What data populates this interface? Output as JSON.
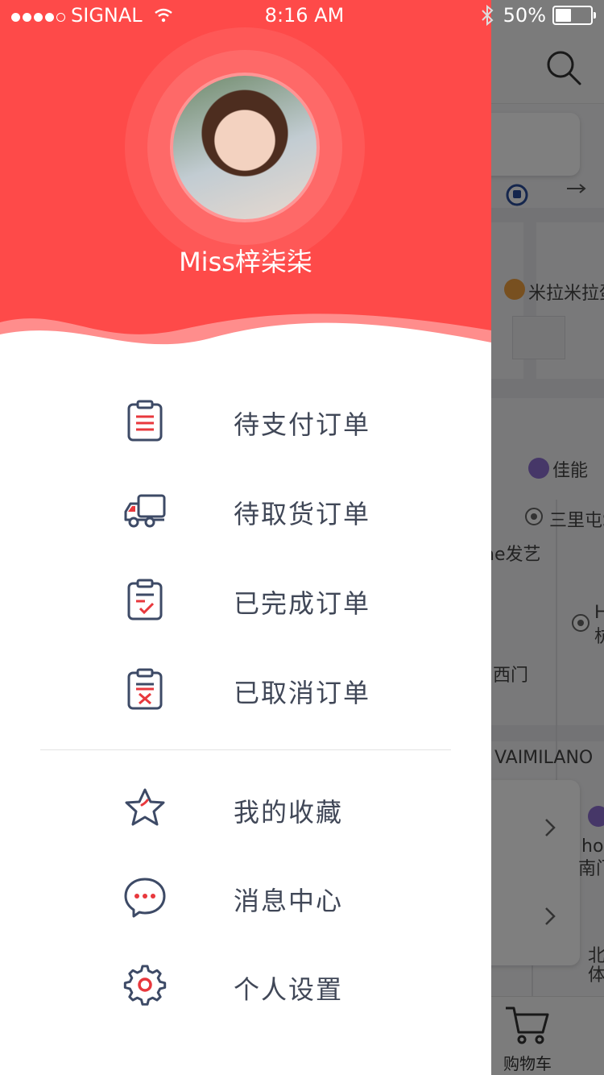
{
  "status_bar": {
    "carrier": "SIGNAL",
    "time": "8:16 AM",
    "battery_percent": "50%",
    "battery_level": 0.5
  },
  "drawer": {
    "username": "Miss梓柒柒",
    "orders_menu": [
      {
        "label": "待支付订单",
        "icon": "clipboard-list-icon"
      },
      {
        "label": "待取货订单",
        "icon": "delivery-truck-icon"
      },
      {
        "label": "已完成订单",
        "icon": "clipboard-check-icon"
      },
      {
        "label": "已取消订单",
        "icon": "clipboard-cancel-icon"
      }
    ],
    "settings_menu": [
      {
        "label": "我的收藏",
        "icon": "star-icon"
      },
      {
        "label": "消息中心",
        "icon": "chat-bubble-icon"
      },
      {
        "label": "个人设置",
        "icon": "gear-icon"
      }
    ],
    "colors": {
      "accent": "#fe4a49",
      "text": "#404757",
      "icon": "#3d4a66",
      "icon_accent": "#e8383d"
    }
  },
  "background_app": {
    "map_labels": [
      "米拉米拉蛋",
      "佳能",
      "三里屯S",
      "he发艺",
      "H",
      "杭",
      "西门",
      "VAIMILANO",
      "ho",
      "南门",
      "北",
      "体"
    ],
    "cart_label": "购物车"
  }
}
